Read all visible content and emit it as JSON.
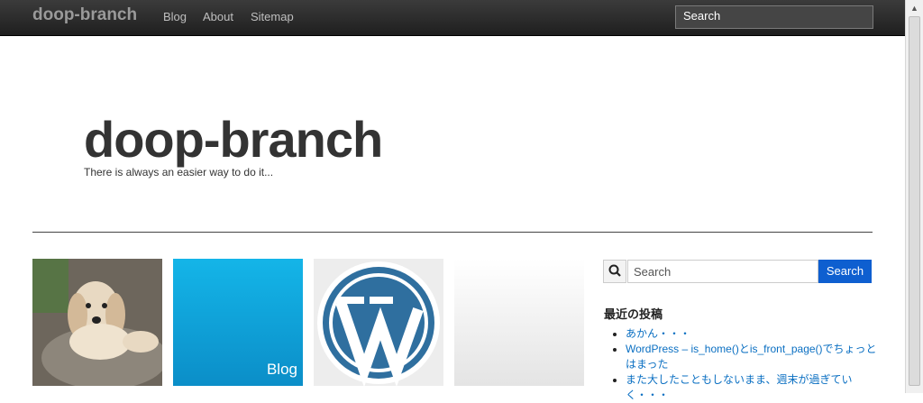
{
  "navbar": {
    "brand": "doop-branch",
    "links": [
      "Blog",
      "About",
      "Sitemap"
    ],
    "search_text": "Search"
  },
  "header": {
    "title": "doop-branch",
    "tagline": "There is always an easier way to do it..."
  },
  "tiles": {
    "blog_label": "Blog"
  },
  "sidebar": {
    "search_placeholder": "Search",
    "search_button": "Search",
    "recent_title": "最近の投稿",
    "recent_posts": [
      "あかん・・・",
      "WordPress – is_home()とis_front_page()でちょっとはまった",
      "また大したこともしないまま、週末が過ぎていく・・・"
    ]
  },
  "colors": {
    "accent": "#0e5fd0",
    "link": "#0a6fc2",
    "blog_tile": "#0ba3dc"
  }
}
